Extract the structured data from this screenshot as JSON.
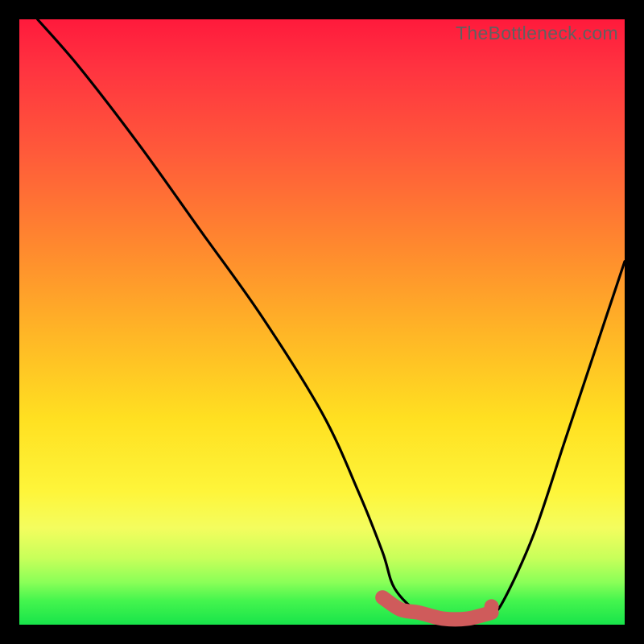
{
  "watermark": "TheBottleneck.com",
  "chart_data": {
    "type": "line",
    "title": "",
    "xlabel": "",
    "ylabel": "",
    "xlim": [
      0,
      100
    ],
    "ylim": [
      0,
      100
    ],
    "series": [
      {
        "name": "curve",
        "x": [
          3,
          10,
          20,
          30,
          40,
          50,
          56,
          60,
          62,
          66,
          70,
          74,
          78,
          80,
          85,
          90,
          95,
          100
        ],
        "y": [
          100,
          92,
          79,
          65,
          51,
          35,
          22,
          12,
          6,
          2,
          1,
          1,
          2,
          4,
          15,
          30,
          45,
          60
        ]
      }
    ],
    "highlight_segment": {
      "x": [
        60,
        63,
        66,
        70,
        74,
        78
      ],
      "y": [
        4.5,
        2.5,
        2,
        1,
        1,
        2
      ]
    },
    "highlight_point": {
      "x": 78,
      "y": 3
    },
    "colors": {
      "curve": "#000000",
      "highlight": "#cf5b5b",
      "gradient_top": "#ff1a3c",
      "gradient_bottom": "#18e44a"
    }
  }
}
